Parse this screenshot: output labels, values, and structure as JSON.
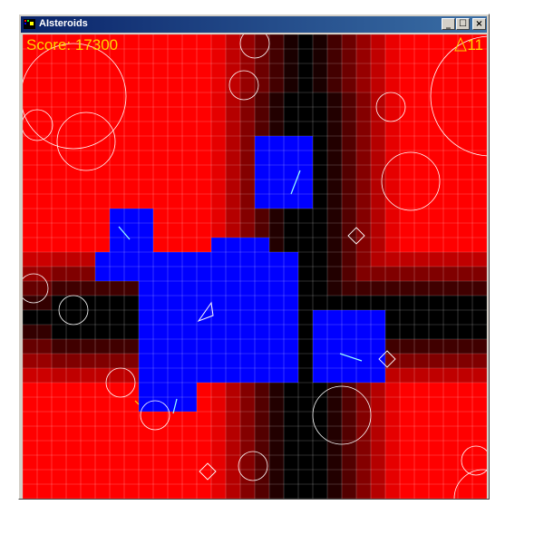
{
  "window": {
    "title": "AIsteroids"
  },
  "window_buttons": [
    "minimize",
    "maximize",
    "close"
  ],
  "hud": {
    "score_text": "Score: 17300",
    "ships_remaining": "11"
  },
  "icons": [
    "app-icon",
    "ship-icon"
  ],
  "colors": {
    "background": "#ff0000",
    "threat_dark": "#000000",
    "safe_zone": "#0000ff",
    "hud_text": "#ffd400"
  }
}
